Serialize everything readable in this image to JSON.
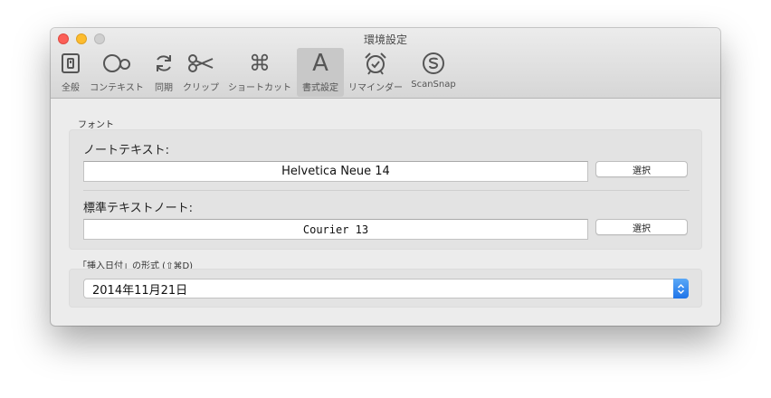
{
  "window": {
    "title": "環境設定"
  },
  "toolbar": {
    "items": [
      {
        "label": "全般",
        "icon": "general-switch-icon"
      },
      {
        "label": "コンテキスト",
        "icon": "context-rings-icon"
      },
      {
        "label": "同期",
        "icon": "sync-arrows-icon"
      },
      {
        "label": "クリップ",
        "icon": "scissors-icon"
      },
      {
        "label": "ショートカット",
        "icon": "command-key-icon"
      },
      {
        "label": "書式設定",
        "icon": "font-a-icon",
        "selected": true
      },
      {
        "label": "リマインダー",
        "icon": "alarm-clock-icon"
      },
      {
        "label": "ScanSnap",
        "icon": "scansnap-icon"
      }
    ]
  },
  "font_section": {
    "heading": "フォント",
    "note_text_label": "ノートテキスト:",
    "note_text_value": "Helvetica Neue 14",
    "plain_text_label": "標準テキストノート:",
    "plain_text_value": "Courier 13",
    "choose_button_label": "選択"
  },
  "date_section": {
    "heading": "「挿入日付」の形式 (⇧⌘D)",
    "selected_format": "2014年11月21日"
  },
  "colors": {
    "accent": "#1f74e8",
    "close": "#fc5f57",
    "minimize": "#fdbc2e"
  }
}
